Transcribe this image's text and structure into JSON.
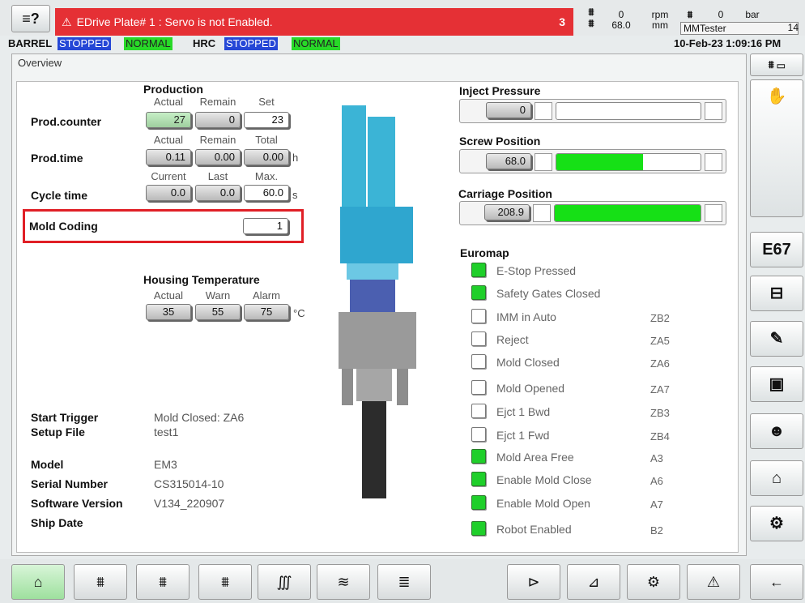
{
  "topbar": {
    "menu_glyph": "≡?",
    "alarm_text": "EDrive Plate# 1 : Servo is not Enabled.",
    "alarm_count": "3",
    "speed_top": "0",
    "speed_bottom": "68.0",
    "unit_top": "rpm",
    "unit_bottom": "mm",
    "pressure": "0",
    "pressure_unit": "bar",
    "user": "MMTester",
    "user_num": "14",
    "datetime": "10-Feb-23 1:09:16 PM"
  },
  "status": {
    "barrel_label": "BARREL",
    "barrel_state": "STOPPED",
    "barrel_mode": "NORMAL",
    "hrc_label": "HRC",
    "hrc_state": "STOPPED",
    "hrc_mode": "NORMAL"
  },
  "overview_tab": "Overview",
  "production": {
    "title": "Production",
    "cols1": [
      "Actual",
      "Remain",
      "Set"
    ],
    "counter_label": "Prod.counter",
    "counter": [
      "27",
      "0",
      "23"
    ],
    "cols2": [
      "Actual",
      "Remain",
      "Total"
    ],
    "time_label": "Prod.time",
    "time": [
      "0.11",
      "0.00",
      "0.00"
    ],
    "time_unit": "h",
    "cols3": [
      "Current",
      "Last",
      "Max."
    ],
    "cycle_label": "Cycle time",
    "cycle": [
      "0.0",
      "0.0",
      "60.0"
    ],
    "cycle_unit": "s",
    "mold_label": "Mold Coding",
    "mold_value": "1"
  },
  "housing": {
    "title": "Housing Temperature",
    "cols": [
      "Actual",
      "Warn",
      "Alarm"
    ],
    "values": [
      "35",
      "55",
      "75"
    ],
    "unit": "°C"
  },
  "info": {
    "start_trigger_label": "Start Trigger",
    "start_trigger": "Mold Closed: ZA6",
    "setup_label": "Setup File",
    "setup": "test1",
    "model_label": "Model",
    "model": "EM3",
    "serial_label": "Serial Number",
    "serial": "CS315014-10",
    "sw_label": "Software Version",
    "sw": "V134_220907",
    "ship_label": "Ship Date"
  },
  "gauges": {
    "inject_label": "Inject Pressure",
    "inject_value": "0",
    "inject_fill": 0,
    "screw_label": "Screw Position",
    "screw_value": "68.0",
    "screw_fill": 0.6,
    "carriage_label": "Carriage Position",
    "carriage_value": "208.9",
    "carriage_fill": 1.0
  },
  "euromap": {
    "title": "Euromap",
    "items": [
      {
        "label": "E-Stop Pressed",
        "code": "",
        "on": true
      },
      {
        "label": "Safety Gates Closed",
        "code": "",
        "on": true
      },
      {
        "label": "IMM in Auto",
        "code": "ZB2",
        "on": false
      },
      {
        "label": "Reject",
        "code": "ZA5",
        "on": false
      },
      {
        "label": "Mold Closed",
        "code": "ZA6",
        "on": false
      },
      {
        "label": "Mold Opened",
        "code": "ZA7",
        "on": false
      },
      {
        "label": "Ejct 1 Bwd",
        "code": "ZB3",
        "on": false
      },
      {
        "label": "Ejct 1 Fwd",
        "code": "ZB4",
        "on": false
      },
      {
        "label": "Mold Area Free",
        "code": "A3",
        "on": true
      },
      {
        "label": "Enable Mold Close",
        "code": "A6",
        "on": true
      },
      {
        "label": "Enable Mold Open",
        "code": "A7",
        "on": true
      },
      {
        "label": "Robot Enabled",
        "code": "B2",
        "on": true
      }
    ]
  },
  "sidebar": {
    "e67": "E67"
  }
}
